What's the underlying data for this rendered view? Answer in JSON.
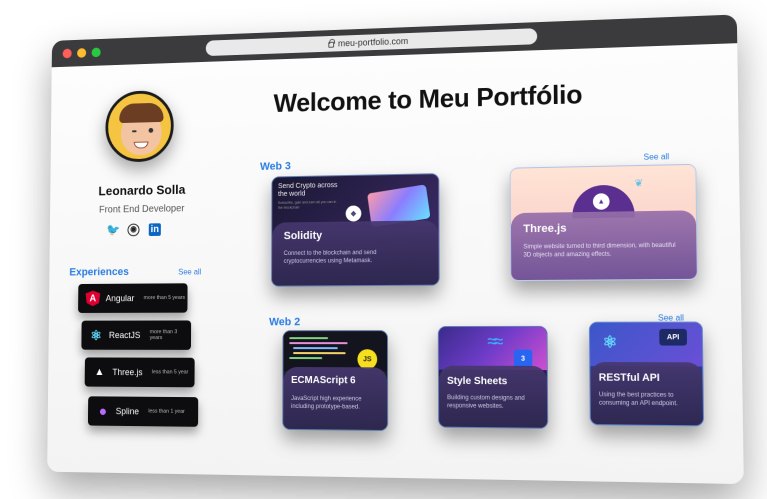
{
  "browser": {
    "url": "meu-portfolio.com"
  },
  "profile": {
    "name": "Leonardo Solla",
    "role": "Front End Developer"
  },
  "socials": [
    {
      "icon": "twitter-icon",
      "glyph": "🐦"
    },
    {
      "icon": "github-icon",
      "glyph": "◉"
    },
    {
      "icon": "linkedin-icon",
      "glyph": "in"
    }
  ],
  "experiences": {
    "title": "Experiences",
    "see_all": "See all",
    "items": [
      {
        "name": "Angular",
        "duration": "more than 5 years",
        "icon": "angular-icon",
        "glyph": "A",
        "color": "#dd0031"
      },
      {
        "name": "ReactJS",
        "duration": "more than 3 years",
        "icon": "react-icon",
        "glyph": "⚛",
        "color": "#61dafb"
      },
      {
        "name": "Three.js",
        "duration": "less than 5 year",
        "icon": "threejs-icon",
        "glyph": "▲",
        "color": "#ffffff"
      },
      {
        "name": "Spline",
        "duration": "less than 1 year",
        "icon": "spline-icon",
        "glyph": "●",
        "color": "#b86bff"
      }
    ]
  },
  "main": {
    "welcome": "Welcome to Meu Portfólio",
    "web3": {
      "title": "Web 3",
      "see_all": "See all",
      "cards": [
        {
          "title": "Solidity",
          "desc": "Connect to the blockchain and send cryptocurrencies using Metamask.",
          "preview_headline": "Send Crypto across the world",
          "preview_sub": "Subscribe, gain and earn all you can in the blockchain"
        },
        {
          "title": "Three.js",
          "desc": "Simple website turned to third dimension, with beautiful 3D objects and amazing effects."
        }
      ]
    },
    "web2": {
      "title": "Web 2",
      "see_all": "See all",
      "cards": [
        {
          "title": "ECMAScript 6",
          "desc": "JavaScript high experience including prototype-based.",
          "badge": "JS"
        },
        {
          "title": "Style Sheets",
          "desc": "Building custom designs and responsive websites.",
          "badge": "3"
        },
        {
          "title": "RESTful API",
          "desc": "Using the best practices to consuming an API endpoint.",
          "badge": "API"
        }
      ]
    }
  }
}
